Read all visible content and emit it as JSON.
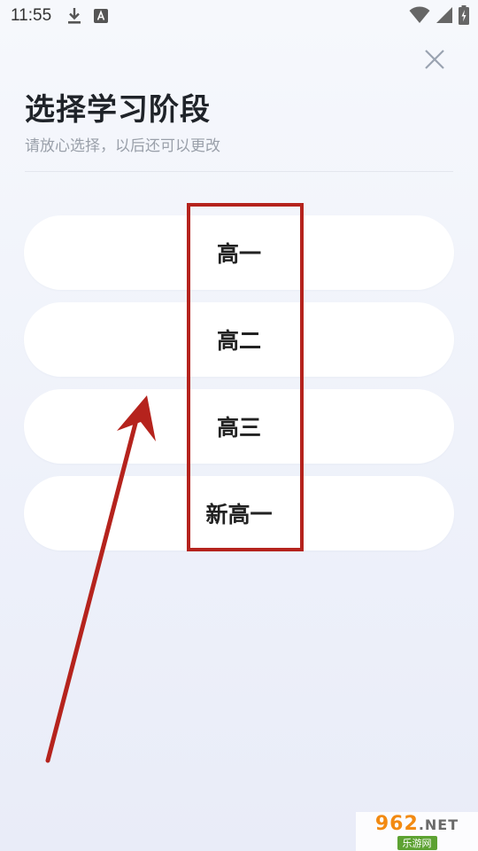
{
  "status_bar": {
    "time": "11:55",
    "icons": [
      "download-icon",
      "a-badge-icon",
      "wifi-icon",
      "signal-icon",
      "battery-icon"
    ]
  },
  "header": {
    "title": "选择学习阶段",
    "subtitle": "请放心选择，以后还可以更改"
  },
  "stages": [
    {
      "label": "高一"
    },
    {
      "label": "高二"
    },
    {
      "label": "高三"
    },
    {
      "label": "新高一"
    }
  ],
  "annotation": {
    "color": "#b5231d"
  },
  "watermark": {
    "logo_main": "962",
    "logo_suffix": ".NET",
    "logo_sub": "乐游网"
  },
  "colors": {
    "background": "#f0f3fa",
    "card": "#ffffff",
    "title": "#1f2329",
    "subtitle": "#9aa0aa"
  }
}
